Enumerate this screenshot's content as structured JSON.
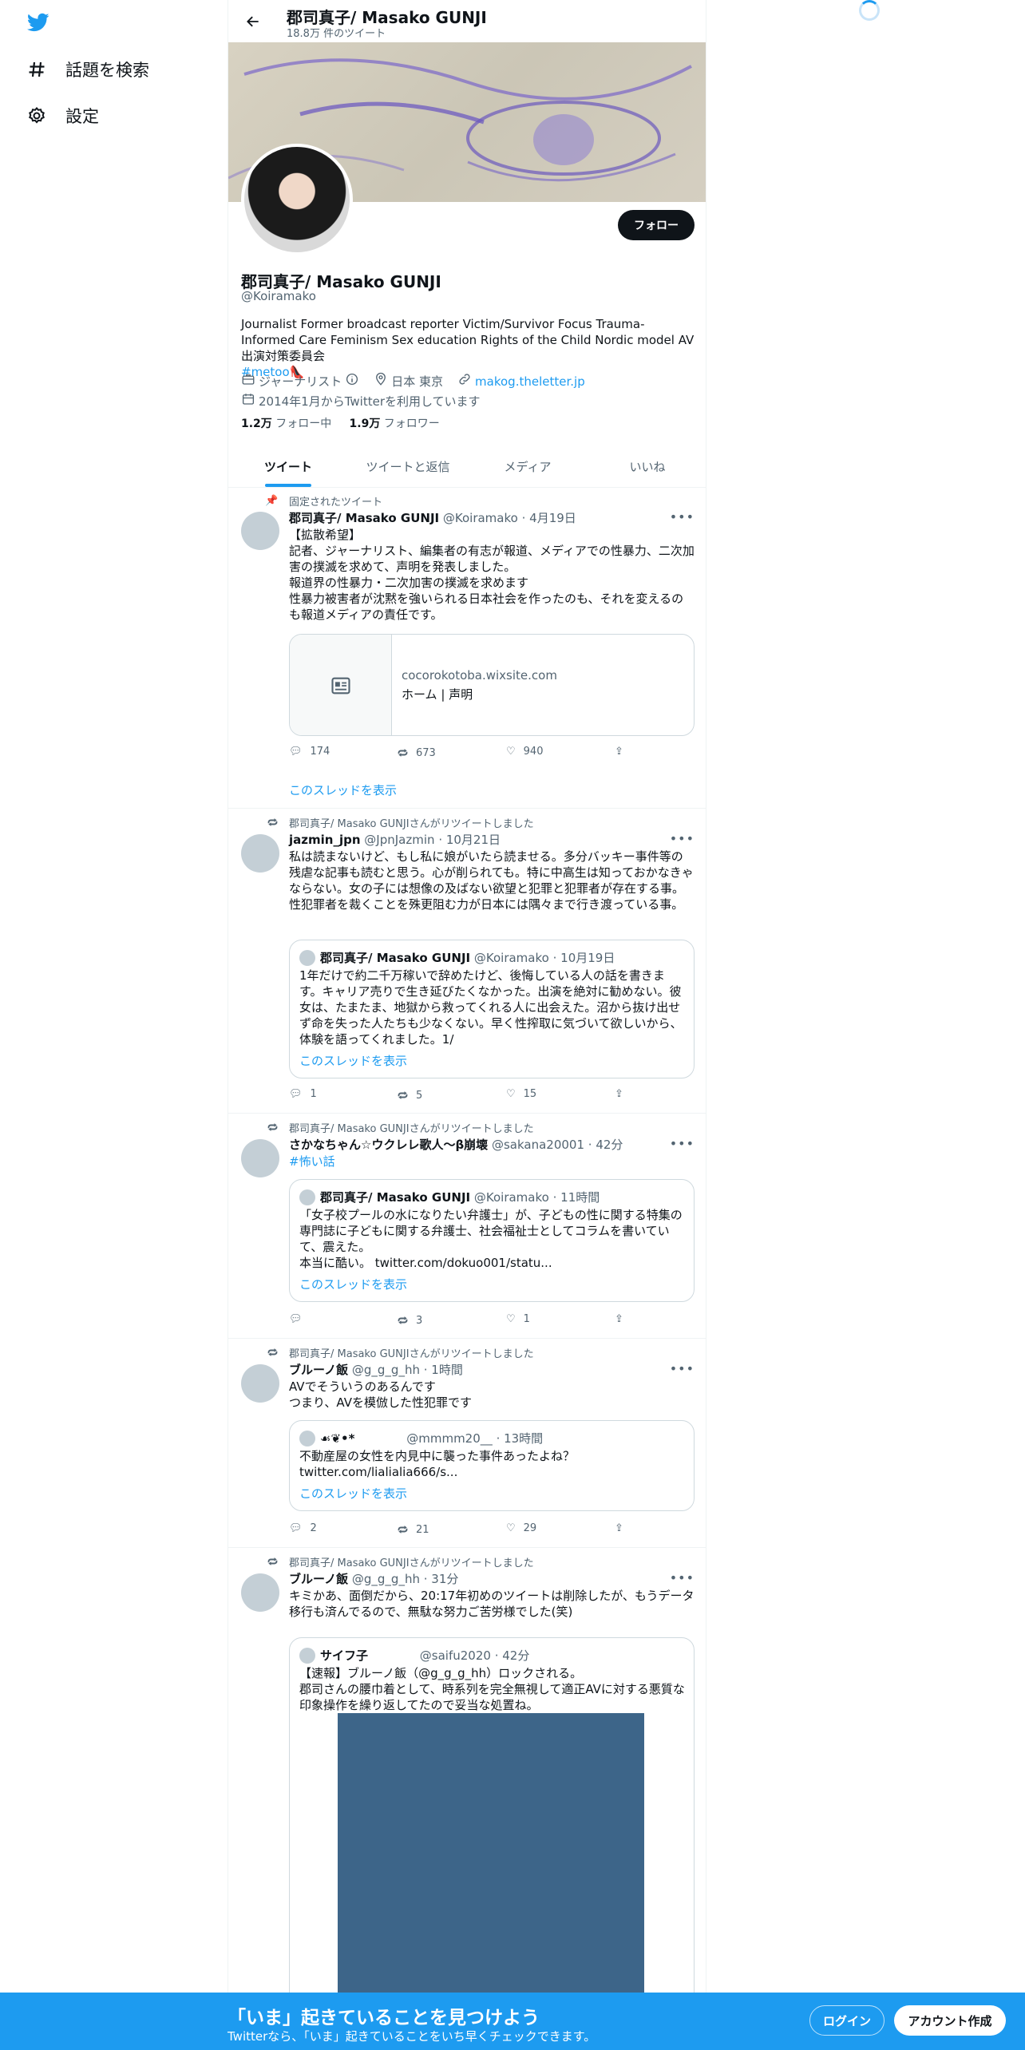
{
  "nav": {
    "explore_label": "話題を検索",
    "settings_label": "設定"
  },
  "header": {
    "name": "郡司真子/ Masako GUNJI",
    "tweet_count": "18.8万 件のツイート"
  },
  "profile": {
    "follow_label": "フォロー",
    "name": "郡司真子/ Masako GUNJI",
    "handle": "@Koiramako",
    "bio": "Journalist Former broadcast reporter Victim/Survivor Focus Trauma-Informed Care Feminism Sex education Rights of the Child Nordic model AV出演対策委員会",
    "bio_hashtag": "#metoo",
    "bio_emoji": "👠",
    "category": "ジャーナリスト",
    "location": "日本 東京",
    "website": "makog.theletter.jp",
    "joined": "2014年1月からTwitterを利用しています",
    "following_count": "1.2万",
    "following_label": "フォロー中",
    "followers_count": "1.9万",
    "followers_label": "フォロワー"
  },
  "tabs": [
    "ツイート",
    "ツイートと返信",
    "メディア",
    "いいね"
  ],
  "tweets": [
    {
      "context": "固定されたツイート",
      "name": "郡司真子/ Masako GUNJI",
      "handle": "@Koiramako",
      "time": "· 4月19日",
      "text": "【拡散希望】\n記者、ジャーナリスト、編集者の有志が報道、メディアでの性暴力、二次加害の撲滅を求めて、声明を発表しました。\n報道界の性暴力・二次加害の撲滅を求めます\n性暴力被害者が沈黙を強いられる日本社会を作ったのも、それを変えるのも報道メディアの責任です。",
      "card_domain": "cocorokotoba.wixsite.com",
      "card_title": "ホーム | 声明",
      "replies": "174",
      "retweets": "673",
      "likes": "940",
      "show_thread": "このスレッドを表示"
    },
    {
      "context": "郡司真子/ Masako GUNJIさんがリツイートしました",
      "name": "jazmin_jpn",
      "handle": "@JpnJazmin",
      "time": "· 10月21日",
      "text": "私は読まないけど、もし私に娘がいたら読ませる。多分バッキー事件等の残虐な記事も読むと思う。心が削られても。特に中高生は知っておかなきゃならない。女の子には想像の及ばない欲望と犯罪と犯罪者が存在する事。性犯罪者を裁くことを殊更阻む力が日本には隅々まで行き渡っている事。",
      "quote_name": "郡司真子/ Masako GUNJI",
      "quote_handle": "@Koiramako",
      "quote_time": "· 10月19日",
      "quote_text": "1年だけで約二千万稼いで辞めたけど、後悔している人の話を書きます。キャリア売りで生き延びたくなかった。出演を絶対に勧めない。彼女は、たまたま、地獄から救ってくれる人に出会えた。沼から抜け出せず命を失った人たちも少なくない。早く性搾取に気づいて欲しいから、体験を語ってくれました。1/",
      "quote_thread": "このスレッドを表示",
      "replies": "1",
      "retweets": "5",
      "likes": "15"
    },
    {
      "context": "郡司真子/ Masako GUNJIさんがリツイートしました",
      "name": "さかなちゃん☆ウクレレ歌人～β崩壊",
      "handle": "@sakana20001",
      "time": "· 42分",
      "text": "#怖い話",
      "quote_name": "郡司真子/ Masako GUNJI",
      "quote_handle": "@Koiramako",
      "quote_time": "· 11時間",
      "quote_text": "「女子校プールの水になりたい弁護士」が、子どもの性に関する特集の専門誌に子どもに関する弁護士、社会福祉士としてコラムを書いていて、震えた。\n本当に酷い。 twitter.com/dokuo001/statu...",
      "quote_thread": "このスレッドを表示",
      "replies": "",
      "retweets": "3",
      "likes": "1"
    },
    {
      "context": "郡司真子/ Masako GUNJIさんがリツイートしました",
      "name": "ブルーノ飯",
      "handle": "@g_g_g_hh",
      "time": "· 1時間",
      "text": "AVでそういうのあるんです\nつまり、AVを模倣した性犯罪です",
      "quote_name": "☙❦•*",
      "quote_handle": "@mmmm20__",
      "quote_time": "· 13時間",
      "quote_text": "不動産屋の女性を内見中に襲った事件あったよね？\ntwitter.com/lialialia666/s...",
      "quote_thread": "このスレッドを表示",
      "replies": "2",
      "retweets": "21",
      "likes": "29"
    },
    {
      "context": "郡司真子/ Masako GUNJIさんがリツイートしました",
      "name": "ブルーノ飯",
      "handle": "@g_g_g_hh",
      "time": "· 31分",
      "text": "キミかあ、面倒だから、20:17年初めのツイートは削除したが、もうデータ移行も済んでるので、無駄な努力ご苦労様でした(笑)",
      "quote_name": "サイフ子",
      "quote_handle": "@saifu2020",
      "quote_time": "· 42分",
      "quote_text": "【速報】ブルーノ飯（@g_g_g_hh）ロックされる。\n郡司さんの腰巾着として、時系列を完全無視して適正AVに対する悪質な印象操作を繰り返してたので妥当な処置ね。"
    }
  ],
  "bottom_bar": {
    "title": "「いま」起きていることを見つけよう",
    "subtitle": "Twitterなら、「いま」起きていることをいち早くチェックできます。",
    "login": "ログイン",
    "signup": "アカウント作成"
  }
}
